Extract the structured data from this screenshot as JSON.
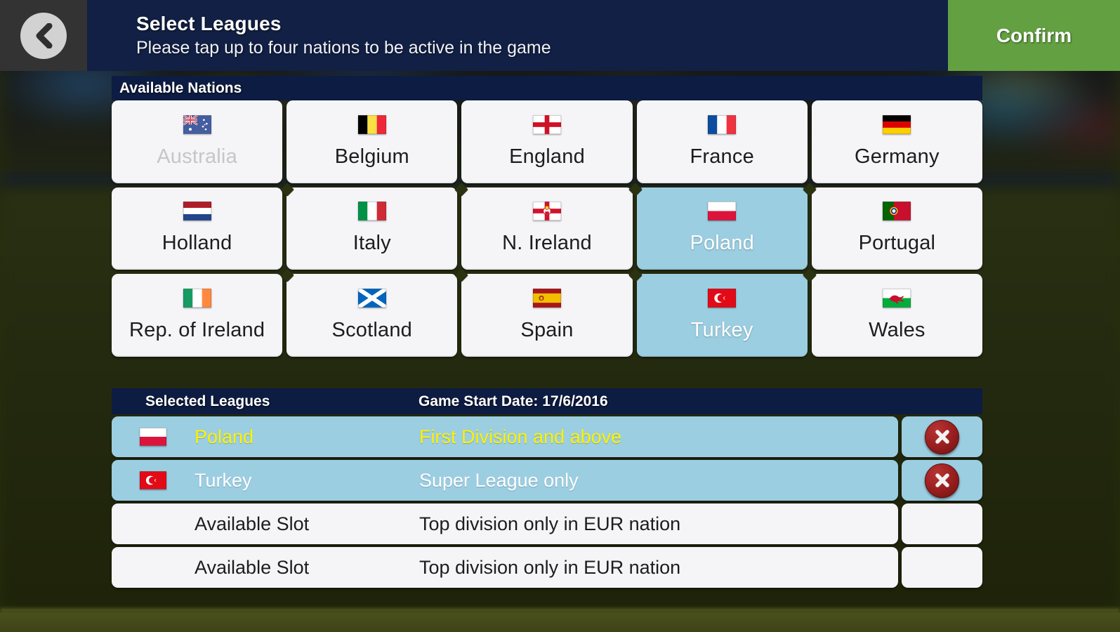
{
  "header": {
    "back_icon": "chevron-left-icon",
    "title": "Select Leagues",
    "subtitle": "Please tap up to four nations to be active in the game",
    "confirm_label": "Confirm",
    "confirm_color": "#63a042",
    "bar_color": "#112044"
  },
  "available_nations": {
    "section_title": "Available Nations",
    "items": [
      {
        "name": "Australia",
        "flag": "flag-australia",
        "state": "disabled"
      },
      {
        "name": "Belgium",
        "flag": "flag-belgium",
        "state": "available"
      },
      {
        "name": "England",
        "flag": "flag-england",
        "state": "available"
      },
      {
        "name": "France",
        "flag": "flag-france",
        "state": "available"
      },
      {
        "name": "Germany",
        "flag": "flag-germany",
        "state": "available"
      },
      {
        "name": "Holland",
        "flag": "flag-holland",
        "state": "available"
      },
      {
        "name": "Italy",
        "flag": "flag-italy",
        "state": "available"
      },
      {
        "name": "N. Ireland",
        "flag": "flag-northern-ireland",
        "state": "available"
      },
      {
        "name": "Poland",
        "flag": "flag-poland",
        "state": "selected"
      },
      {
        "name": "Portugal",
        "flag": "flag-portugal",
        "state": "available"
      },
      {
        "name": "Rep. of Ireland",
        "flag": "flag-ireland",
        "state": "available"
      },
      {
        "name": "Scotland",
        "flag": "flag-scotland",
        "state": "available"
      },
      {
        "name": "Spain",
        "flag": "flag-spain",
        "state": "available"
      },
      {
        "name": "Turkey",
        "flag": "flag-turkey",
        "state": "selected"
      },
      {
        "name": "Wales",
        "flag": "flag-wales",
        "state": "available"
      }
    ],
    "selected_color": "#9ccee2",
    "card_color": "#f5f5f8"
  },
  "selected_leagues": {
    "section_title": "Selected Leagues",
    "game_start_label": "Game Start Date: 17/6/2016",
    "rows": [
      {
        "nation": "Poland",
        "flag": "flag-poland",
        "description": "First Division and above",
        "filled": true,
        "text_color": "#fff300",
        "delete_icon": "close-circle-icon"
      },
      {
        "nation": "Turkey",
        "flag": "flag-turkey",
        "description": "Super League only",
        "filled": true,
        "text_color": "#ffffff",
        "delete_icon": "close-circle-icon"
      },
      {
        "nation": "Available Slot",
        "flag": "",
        "description": "Top division only in EUR nation",
        "filled": false,
        "text_color": "#1d1d1d",
        "delete_icon": ""
      },
      {
        "nation": "Available Slot",
        "flag": "",
        "description": "Top division only in EUR nation",
        "filled": false,
        "text_color": "#1d1d1d",
        "delete_icon": ""
      }
    ]
  }
}
